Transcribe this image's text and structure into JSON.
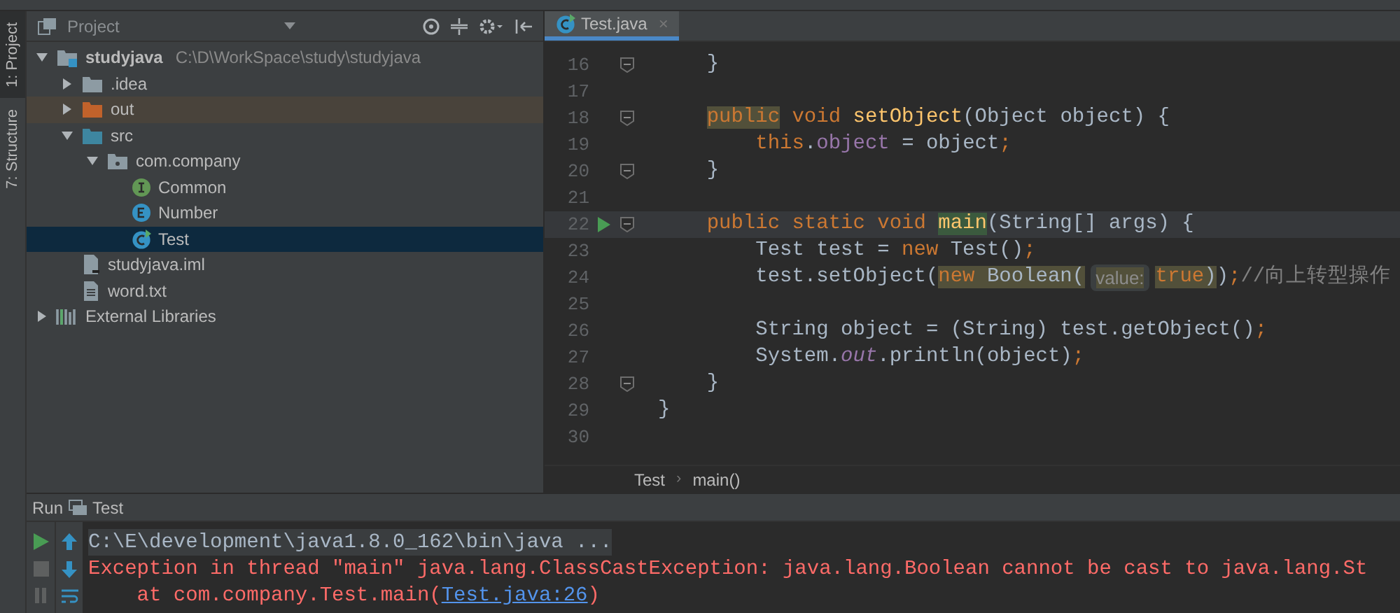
{
  "side_tabs": [
    {
      "label": "1: Project",
      "selected": true
    },
    {
      "label": "7: Structure",
      "selected": false
    }
  ],
  "project_panel": {
    "title": "Project",
    "tree": [
      {
        "label": "studyjava",
        "path": "C:\\D\\WorkSpace\\study\\studyjava",
        "kind": "module",
        "expanded": true,
        "selected": false,
        "children": [
          {
            "label": ".idea",
            "kind": "folder",
            "expanded": false,
            "selected": false
          },
          {
            "label": "out",
            "kind": "excluded",
            "expanded": false,
            "selected": false
          },
          {
            "label": "src",
            "kind": "source",
            "expanded": true,
            "selected": false,
            "children": [
              {
                "label": "com.company",
                "kind": "package",
                "expanded": true,
                "selected": false,
                "children": [
                  {
                    "label": "Common",
                    "kind": "interface",
                    "selected": false
                  },
                  {
                    "label": "Number",
                    "kind": "enum",
                    "selected": false
                  },
                  {
                    "label": "Test",
                    "kind": "class",
                    "selected": true
                  }
                ]
              }
            ]
          },
          {
            "label": "studyjava.iml",
            "kind": "iml",
            "selected": false
          },
          {
            "label": "word.txt",
            "kind": "text",
            "selected": false
          }
        ]
      },
      {
        "label": "External Libraries",
        "kind": "libraries",
        "expanded": false,
        "selected": false
      }
    ]
  },
  "editor": {
    "tabs": [
      {
        "label": "Test.java",
        "close": "×",
        "selected": true
      }
    ],
    "lines": [
      {
        "number": "16",
        "fold": true,
        "run": false,
        "current": false,
        "tokens": [
          {
            "text": "    }",
            "kind": "plain",
            "highlighted": false
          }
        ]
      },
      {
        "number": "17",
        "fold": false,
        "run": false,
        "current": false
      },
      {
        "number": "18",
        "fold": true,
        "run": false,
        "current": false,
        "tokens": [
          {
            "text": "    public",
            "kind": "kw",
            "highlighted": true
          },
          {
            "text": " void ",
            "kind": "kw",
            "highlighted": false
          },
          {
            "text": "setObject",
            "kind": "method",
            "highlighted": false
          },
          {
            "text": "(Object object) {",
            "kind": "plain",
            "highlighted": false
          }
        ]
      },
      {
        "number": "19",
        "fold": false,
        "run": false,
        "current": false,
        "tokens": [
          {
            "text": "        this",
            "kind": "kw",
            "highlighted": false
          },
          {
            "text": ".",
            "kind": "plain",
            "highlighted": false
          },
          {
            "text": "object",
            "kind": "field",
            "highlighted": false
          },
          {
            "text": " = object",
            "kind": "plain",
            "highlighted": false
          },
          {
            "text": ";",
            "kind": "kw",
            "highlighted": false
          }
        ]
      },
      {
        "number": "20",
        "fold": true,
        "run": false,
        "current": false,
        "tokens": [
          {
            "text": "    }",
            "kind": "plain",
            "highlighted": false
          }
        ]
      },
      {
        "number": "21",
        "fold": false,
        "run": false,
        "current": false
      },
      {
        "number": "22",
        "fold": true,
        "run": true,
        "current": true,
        "tokens": [
          {
            "text": "    public static void ",
            "kind": "kw",
            "highlighted": false
          },
          {
            "text": "main",
            "kind": "method",
            "highlighted": true
          },
          {
            "text": "(String[] args) {",
            "kind": "plain",
            "highlighted": false
          }
        ]
      },
      {
        "number": "23",
        "fold": false,
        "run": false,
        "current": false,
        "tokens": [
          {
            "text": "        Test test = ",
            "kind": "plain",
            "highlighted": false
          },
          {
            "text": "new ",
            "kind": "kw",
            "highlighted": false
          },
          {
            "text": "Test()",
            "kind": "plain",
            "highlighted": false
          },
          {
            "text": ";",
            "kind": "kw",
            "highlighted": false
          }
        ]
      },
      {
        "number": "24",
        "fold": false,
        "run": false,
        "current": false,
        "tokens": [
          {
            "text": "        test.setObject(",
            "kind": "plain",
            "highlighted": false
          },
          {
            "text": "new ",
            "kind": "kw",
            "highlighted": true
          },
          {
            "text": "Boolean(",
            "kind": "plain",
            "highlighted": true
          },
          {
            "text": "value:",
            "kind": "hint",
            "highlighted": true
          },
          {
            "text": "true",
            "kind": "kw",
            "highlighted": true
          },
          {
            "text": ")",
            "kind": "plain",
            "highlighted": true
          },
          {
            "text": ")",
            "kind": "plain",
            "highlighted": false
          },
          {
            "text": ";",
            "kind": "kw",
            "highlighted": false
          },
          {
            "text": "//向上转型操作",
            "kind": "comment",
            "highlighted": false
          }
        ]
      },
      {
        "number": "25",
        "fold": false,
        "run": false,
        "current": false
      },
      {
        "number": "26",
        "fold": false,
        "run": false,
        "current": false,
        "tokens": [
          {
            "text": "        String object = (String) test.getObject()",
            "kind": "plain",
            "highlighted": false
          },
          {
            "text": ";",
            "kind": "kw",
            "highlighted": false
          }
        ]
      },
      {
        "number": "27",
        "fold": false,
        "run": false,
        "current": false,
        "tokens": [
          {
            "text": "        System.",
            "kind": "plain",
            "highlighted": false
          },
          {
            "text": "out",
            "kind": "static",
            "highlighted": false
          },
          {
            "text": ".println(object)",
            "kind": "plain",
            "highlighted": false
          },
          {
            "text": ";",
            "kind": "kw",
            "highlighted": false
          }
        ]
      },
      {
        "number": "28",
        "fold": true,
        "run": false,
        "current": false,
        "tokens": [
          {
            "text": "    }",
            "kind": "plain",
            "highlighted": false
          }
        ]
      },
      {
        "number": "29",
        "fold": false,
        "run": false,
        "current": false,
        "tokens": [
          {
            "text": "}",
            "kind": "plain",
            "highlighted": false
          }
        ]
      },
      {
        "number": "30",
        "fold": false,
        "run": false,
        "current": false
      }
    ],
    "breadcrumbs": [
      {
        "label": "Test"
      },
      {
        "separator": "›",
        "label": "main()"
      }
    ]
  },
  "run_panel": {
    "title": "Run",
    "config": "Test",
    "console": [
      [
        {
          "text": "C:\\E\\development\\java1.8.0_162\\bin\\java ...",
          "kind": "command"
        }
      ],
      [
        {
          "text": "Exception in thread \"main\" java.lang.ClassCastException: java.lang.Boolean cannot be cast to java.lang.St",
          "kind": "error"
        }
      ],
      [
        {
          "text": "    at com.company.Test.main(",
          "kind": "error"
        },
        {
          "text": "Test.java:26",
          "kind": "link"
        },
        {
          "text": ")",
          "kind": "error"
        }
      ]
    ]
  }
}
